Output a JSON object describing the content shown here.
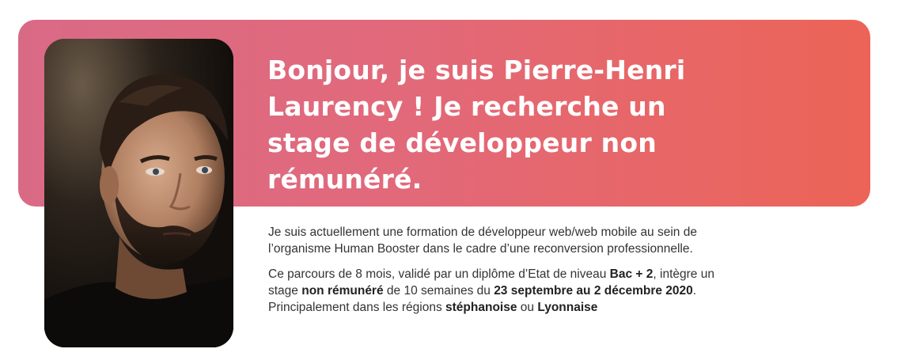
{
  "hero": {
    "headline": "Bonjour, je suis Pierre-Henri Laurency ! Je recherche un stage de développeur non rémunéré.",
    "photo_alt": "Portrait de Pierre-Henri Laurency",
    "gradient_start": "#d96a86",
    "gradient_end": "#ec6457"
  },
  "intro": {
    "paragraph1": "Je suis actuellement une formation de développeur web/web mobile au sein de l’organisme Human Booster dans le cadre d’une reconversion professionnelle.",
    "p2_t1": "Ce parcours de 8 mois, validé par un diplôme d’Etat de niveau ",
    "p2_b1": "Bac + 2",
    "p2_t2": ", intègre un stage ",
    "p2_b2": "non rémunéré",
    "p2_t3": " de 10 semaines du ",
    "p2_b3": "23 septembre au 2 décembre 2020",
    "p2_t4": ". Principalement dans les régions ",
    "p2_b4": "stéphanoise",
    "p2_t5": " ou ",
    "p2_b5": "Lyonnaise"
  }
}
